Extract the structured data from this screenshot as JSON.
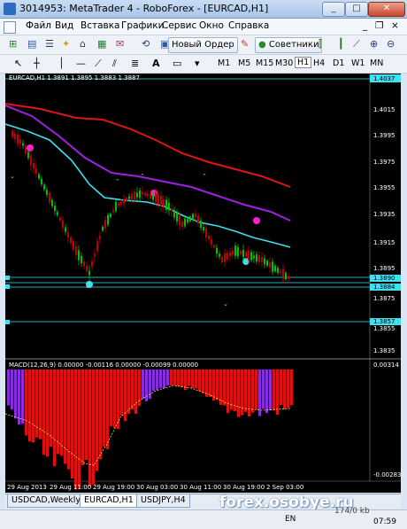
{
  "window": {
    "title": "3014953: MetaTrader 4 - RoboForex - [EURCAD,H1]",
    "minimize": "_",
    "maximize": "□",
    "close": "✕"
  },
  "menu": {
    "items": [
      "Файл",
      "Вид",
      "Вставка",
      "Графики",
      "Сервис",
      "Окно",
      "Справка"
    ],
    "doc_min": "_",
    "doc_restore": "❐",
    "doc_close": "×"
  },
  "toolbar": {
    "new_order": "Новый Ордер",
    "advisors": "Советники",
    "text_tool": "A",
    "timeframes": [
      "M1",
      "M5",
      "M15",
      "M30",
      "H1",
      "H4",
      "D1",
      "W1",
      "MN"
    ],
    "active_timeframe": "H1"
  },
  "chart": {
    "symbol_header": "EURCAD,H1  1.3891 1.3895 1.3883 1.3887",
    "macd_header": "MACD(12,26,9) 0.00000 -0.00116 0.00000 -0.00099 0.00000",
    "price_labels": [
      "1.4037",
      "1.4015",
      "1.3995",
      "1.3975",
      "1.3955",
      "1.3935",
      "1.3915",
      "1.3895",
      "1.3890",
      "1.3884",
      "1.3875",
      "1.3857",
      "1.3855",
      "1.3835"
    ],
    "macd_labels": [
      "0.00314",
      "0.00",
      "-0.00283"
    ],
    "time_labels": [
      "29 Aug 2013",
      "29 Aug 11:00",
      "29 Aug 19:00",
      "30 Aug 03:00",
      "30 Aug 11:00",
      "30 Aug 19:00",
      "2 Sep 03:00"
    ],
    "colors": {
      "background": "#000000",
      "bull_candle": "#00c000",
      "bear_candle": "#c00000",
      "ma_slow": "#e01515",
      "ma_mid": "#a020e0",
      "ma_fast": "#40e0f0",
      "levels": "#40e0f0",
      "macd_bull": "#8a2be2",
      "macd_bear": "#e01010",
      "signal": "#e8e840"
    }
  },
  "tabs": {
    "items": [
      "USDCAD,Weekly",
      "EURCAD,H1",
      "USDJPY,H4"
    ],
    "active": "EURCAD,H1"
  },
  "watermark": "forex.osobye.ru",
  "status": {
    "speed": "174/0 kb",
    "lang": "EN",
    "clock": "07:59"
  }
}
